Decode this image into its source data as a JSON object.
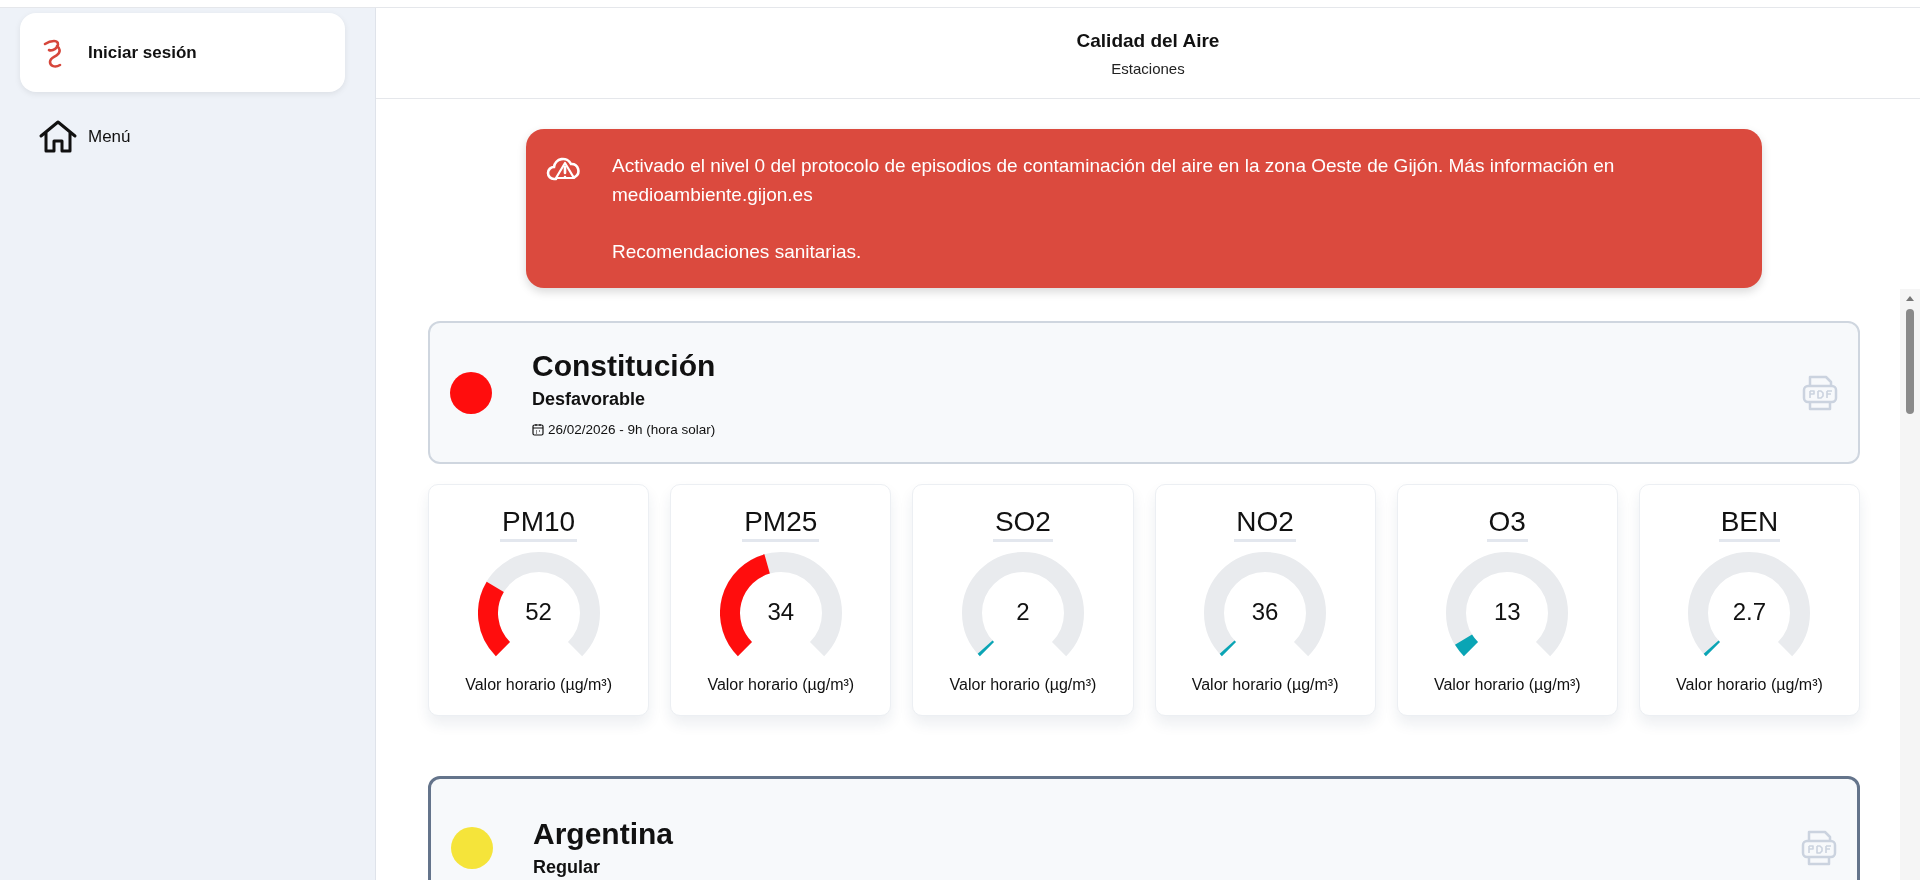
{
  "sidebar": {
    "login": {
      "label": "Iniciar sesión"
    },
    "items": [
      {
        "label": "Menú"
      }
    ]
  },
  "header": {
    "title": "Calidad del Aire",
    "subtitle": "Estaciones"
  },
  "alert": {
    "lines": [
      "Activado el nivel 0 del protocolo de episodios de contaminación del aire en la zona Oeste de Gijón. Más información en medioambiente.gijon.es",
      "Recomendaciones sanitarias."
    ]
  },
  "stations": [
    {
      "name": "Constitución",
      "status": "Desfavorable",
      "color": "#ff0d0d",
      "selected": false,
      "date": "26/02/2026 - 9h (hora solar)",
      "gauges": [
        {
          "pollutant": "PM10",
          "value": "52",
          "unit": "Valor horario (µg/m³)",
          "color": "#ff0d0d"
        },
        {
          "pollutant": "PM25",
          "value": "34",
          "unit": "Valor horario (µg/m³)",
          "color": "#ff0d0d"
        },
        {
          "pollutant": "SO2",
          "value": "2",
          "unit": "Valor horario (µg/m³)",
          "color": "#0aa5b5"
        },
        {
          "pollutant": "NO2",
          "value": "36",
          "unit": "Valor horario (µg/m³)",
          "color": "#0aa5b5"
        },
        {
          "pollutant": "O3",
          "value": "13",
          "unit": "Valor horario (µg/m³)",
          "color": "#0aa5b5"
        },
        {
          "pollutant": "BEN",
          "value": "2.7",
          "unit": "Valor horario (µg/m³)",
          "color": "#0aa5b5"
        }
      ]
    },
    {
      "name": "Argentina",
      "status": "Regular",
      "color": "#f5e43a",
      "selected": true
    }
  ]
}
